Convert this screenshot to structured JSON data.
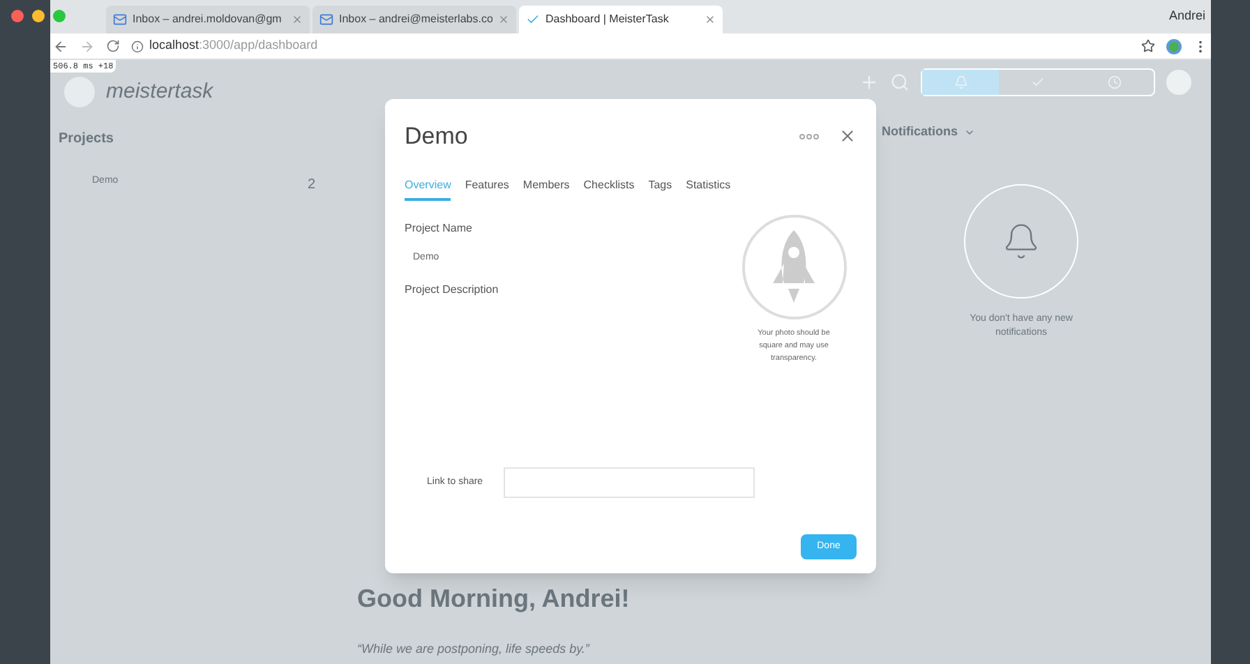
{
  "browser": {
    "tabs": [
      {
        "title": "Inbox – andrei.moldovan@gm",
        "selected": false,
        "kind": "mail"
      },
      {
        "title": "Inbox – andrei@meisterlabs.co",
        "selected": false,
        "kind": "mail"
      },
      {
        "title": "Dashboard | MeisterTask",
        "selected": true,
        "kind": "check"
      }
    ],
    "user": "Andrei",
    "url_host": "localhost",
    "url_path": ":3000/app/dashboard",
    "timing_badge": "506.8 ms +18"
  },
  "background": {
    "logo": "meistertask",
    "projects_heading": "Projects",
    "projects": [
      {
        "name": "Demo",
        "count": "2"
      }
    ],
    "notifications_heading": "Notifications",
    "notifications_empty": "You don't have any new notifications",
    "greeting": "Good Morning, Andrei!",
    "quote": "“While we are postponing, life speeds by.”"
  },
  "dialog": {
    "title": "Demo",
    "tabs": [
      {
        "label": "Overview",
        "selected": true
      },
      {
        "label": "Features",
        "selected": false
      },
      {
        "label": "Members",
        "selected": false
      },
      {
        "label": "Checklists",
        "selected": false
      },
      {
        "label": "Tags",
        "selected": false
      },
      {
        "label": "Statistics",
        "selected": false
      }
    ],
    "project_name_label": "Project Name",
    "project_name": "Demo",
    "description_label": "Project Description",
    "photo_hint": "Your photo should be square and may use transparency.",
    "link_label": "Link to share",
    "done_button": "Done"
  }
}
